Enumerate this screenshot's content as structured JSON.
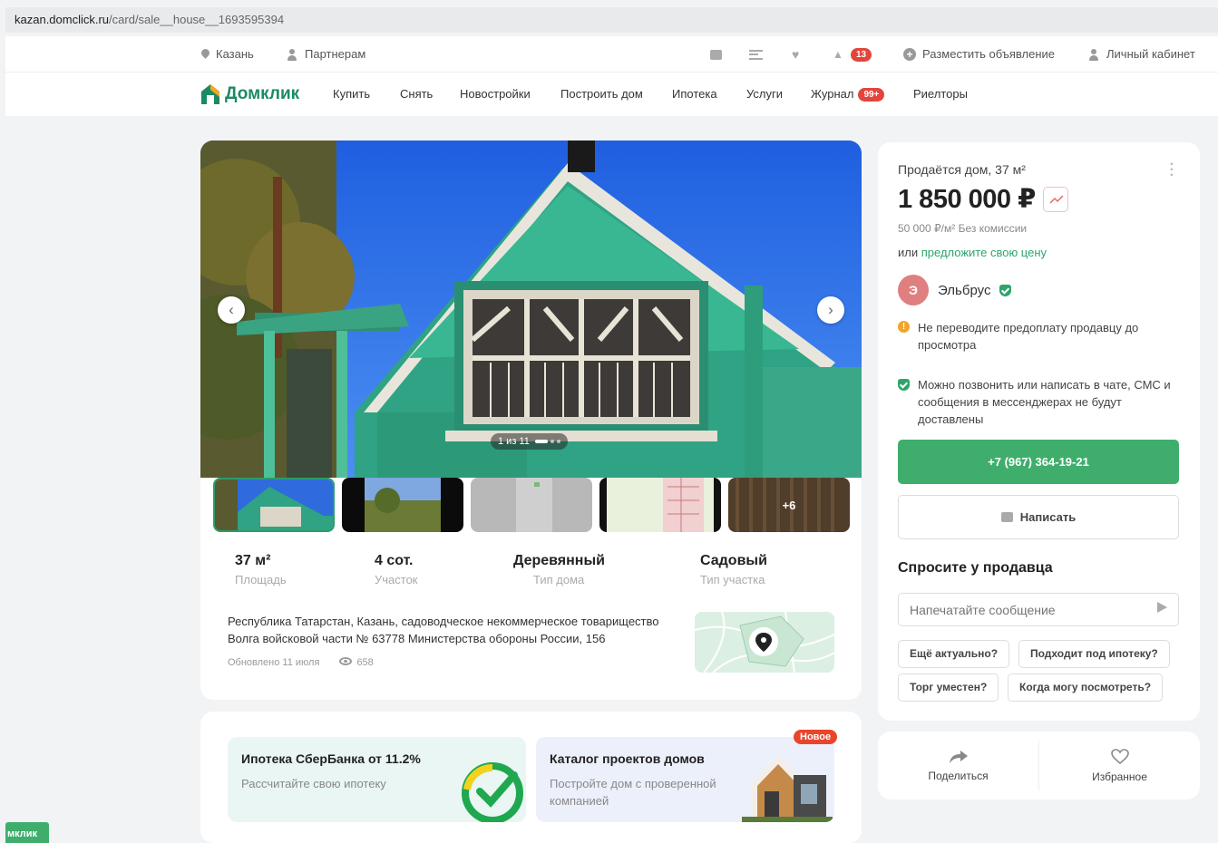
{
  "browser": {
    "url_domain": "kazan.domclick.ru",
    "url_path": "/card/sale__house__1693595394"
  },
  "topbar": {
    "city": "Казань",
    "partners": "Партнерам",
    "notifications_count": "13",
    "post_ad": "Разместить объявление",
    "cabinet": "Личный кабинет"
  },
  "nav": {
    "logo": "Домклик",
    "items": [
      "Купить",
      "Снять",
      "Новостройки",
      "Построить дом",
      "Ипотека",
      "Услуги",
      "Журнал",
      "Риелторы"
    ],
    "journal_badge": "99+"
  },
  "gallery": {
    "counter": "1 из 11",
    "more_photos": "+6",
    "prev_icon": "chevron-left-icon",
    "next_icon": "chevron-right-icon"
  },
  "specs": [
    {
      "value": "37 м²",
      "label": "Площадь"
    },
    {
      "value": "4 сот.",
      "label": "Участок"
    },
    {
      "value": "Деревянный",
      "label": "Тип дома"
    },
    {
      "value": "Садовый",
      "label": "Тип участка"
    }
  ],
  "listing": {
    "address": "Республика Татарстан, Казань, садоводческое некоммерческое товарищество Волга войсковой части № 63778 Министерства обороны России, 156",
    "updated": "Обновлено 11 июля",
    "views": "658"
  },
  "promos": [
    {
      "title": "Ипотека СберБанка от 11.2%",
      "subtitle": "Рассчитайте свою ипотеку"
    },
    {
      "title": "Каталог проектов домов",
      "subtitle": "Постройте дом с проверенной компанией",
      "badge": "Новое"
    }
  ],
  "sidebar": {
    "title": "Продаётся дом, 37 м²",
    "price": "1 850 000 ₽",
    "price_per_m2": "50 000 ₽/м²  Без комиссии",
    "offer_prefix": "или ",
    "offer_link": "предложите свою цену",
    "seller_initial": "Э",
    "seller_name": "Эльбрус",
    "warning": "Не переводите предоплату продавцу до просмотра",
    "info": "Можно позвонить или написать в чате, СМС и сообщения в мессенджерах не будут доставлены",
    "phone": "+7 (967) 364-19-21",
    "write": "Написать",
    "ask_title": "Спросите у продавца",
    "message_placeholder": "Напечатайте сообщение",
    "quick_questions": [
      "Ещё актуально?",
      "Подходит под ипотеку?",
      "Торг уместен?",
      "Когда могу посмотреть?"
    ]
  },
  "actions": {
    "share": "Поделиться",
    "favorite": "Избранное"
  },
  "corner_tag": "мклик",
  "colors": {
    "brand_green": "#3fae6c",
    "logo_green": "#1c8a63",
    "badge_red": "#e2453c"
  }
}
